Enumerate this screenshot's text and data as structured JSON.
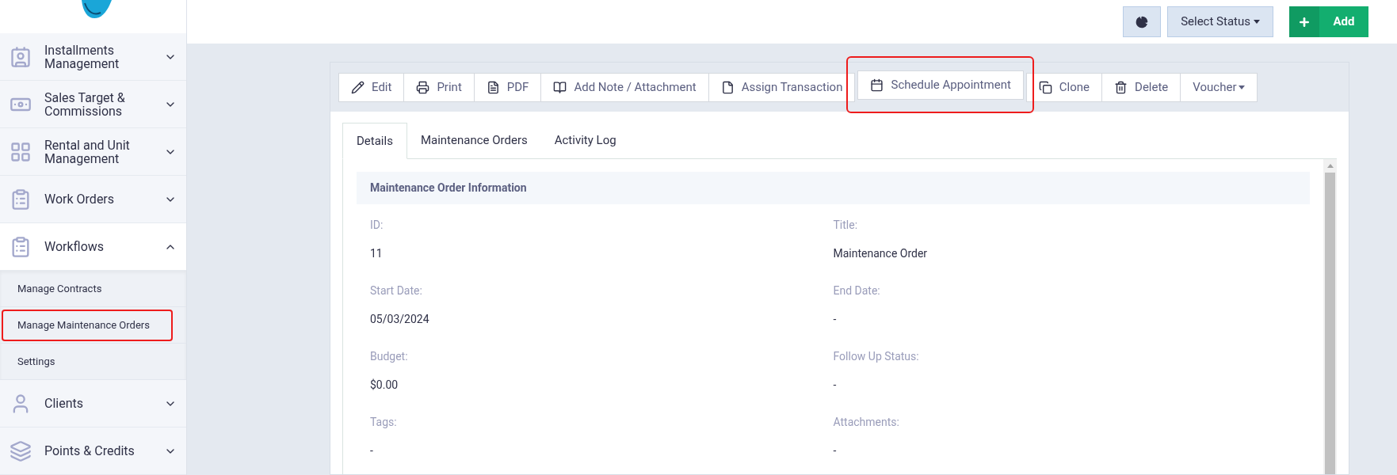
{
  "top_bar": {
    "status_select": {
      "label": "Select Status"
    },
    "add_button": {
      "label": "Add"
    }
  },
  "sidebar": {
    "items": [
      {
        "label": "Installments Management",
        "expanded": false
      },
      {
        "label": "Sales Target & Commissions",
        "expanded": false
      },
      {
        "label": "Rental and Unit Management",
        "expanded": false
      },
      {
        "label": "Work Orders",
        "expanded": false
      },
      {
        "label": "Workflows",
        "expanded": true,
        "children": [
          {
            "label": "Manage Contracts",
            "highlighted": false
          },
          {
            "label": "Manage Maintenance Orders",
            "highlighted": true
          },
          {
            "label": "Settings",
            "highlighted": false
          }
        ]
      },
      {
        "label": "Clients",
        "expanded": false
      },
      {
        "label": "Points & Credits",
        "expanded": false
      }
    ]
  },
  "toolbar": [
    {
      "label": "Edit",
      "kind": "button",
      "highlighted": false
    },
    {
      "label": "Print",
      "kind": "button",
      "highlighted": false
    },
    {
      "label": "PDF",
      "kind": "button",
      "highlighted": false
    },
    {
      "label": "Add Note / Attachment",
      "kind": "button",
      "highlighted": false
    },
    {
      "label": "Assign Transaction",
      "kind": "button",
      "highlighted": false
    },
    {
      "label": "Schedule Appointment",
      "kind": "button",
      "highlighted": true
    },
    {
      "label": "Clone",
      "kind": "button",
      "highlighted": false
    },
    {
      "label": "Delete",
      "kind": "button",
      "highlighted": false
    },
    {
      "label": "Voucher",
      "kind": "dropdown",
      "highlighted": false
    }
  ],
  "tabs": [
    {
      "label": "Details",
      "selected": true
    },
    {
      "label": "Maintenance Orders",
      "selected": false
    },
    {
      "label": "Activity Log",
      "selected": false
    }
  ],
  "section": {
    "title": "Maintenance Order Information",
    "fields": [
      {
        "label": "ID:",
        "value": "11"
      },
      {
        "label": "Title:",
        "value": "Maintenance Order"
      },
      {
        "label": "Start Date:",
        "value": "05/03/2024"
      },
      {
        "label": "End Date:",
        "value": "-"
      },
      {
        "label": "Budget:",
        "value": "$0.00"
      },
      {
        "label": "Follow Up Status:",
        "value": "-"
      },
      {
        "label": "Tags:",
        "value": "-"
      },
      {
        "label": "Attachments:",
        "value": "-"
      }
    ]
  }
}
